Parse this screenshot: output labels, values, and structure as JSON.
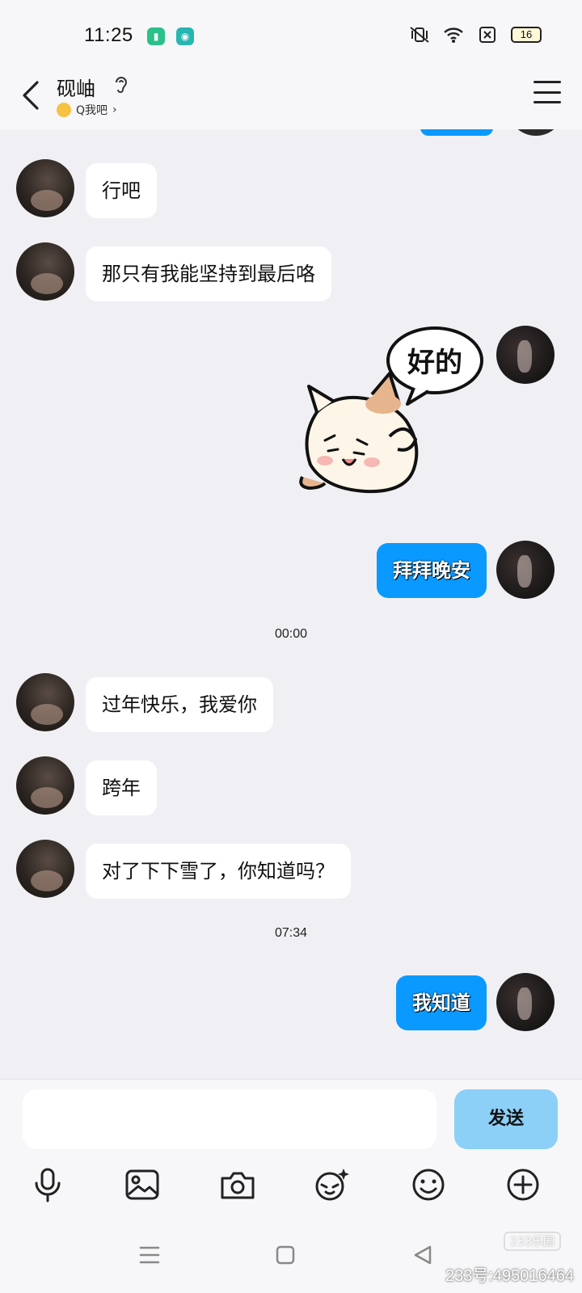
{
  "status_bar": {
    "time": "11:25",
    "app_icon_1": "battery-saver-icon",
    "app_icon_2": "app-notification-icon",
    "battery_level": "16"
  },
  "header": {
    "title": "砚岫",
    "subtitle": "Q我吧",
    "icons": [
      "back-icon",
      "ear-icon",
      "menu-icon"
    ]
  },
  "messages": [
    {
      "from": "other",
      "text": "行吧"
    },
    {
      "from": "other",
      "text": "那只有我能坚持到最后咯"
    },
    {
      "from": "me",
      "sticker_text": "好的"
    },
    {
      "from": "me",
      "text": "拜拜晚安"
    },
    {
      "timestamp": "00:00"
    },
    {
      "from": "other",
      "text": "过年快乐，我爱你"
    },
    {
      "from": "other",
      "text": "跨年"
    },
    {
      "from": "other",
      "text": "对了下下雪了，你知道吗？"
    },
    {
      "timestamp": "07:34"
    },
    {
      "from": "me",
      "text": "我知道"
    }
  ],
  "input": {
    "value": "",
    "send_label": "发送"
  },
  "toolbar": [
    "microphone-icon",
    "image-icon",
    "camera-icon",
    "sticker-search-icon",
    "emoji-icon",
    "plus-icon"
  ],
  "navbar": [
    "recent-apps-icon",
    "home-icon",
    "back-nav-icon"
  ],
  "watermark": {
    "logo": "233乐园",
    "text": "233号:495016464"
  },
  "colors": {
    "outgoing_bubble": "#0a99ff",
    "incoming_bubble": "#ffffff",
    "background": "#f0f0f4",
    "send_button": "#8ccff7"
  }
}
